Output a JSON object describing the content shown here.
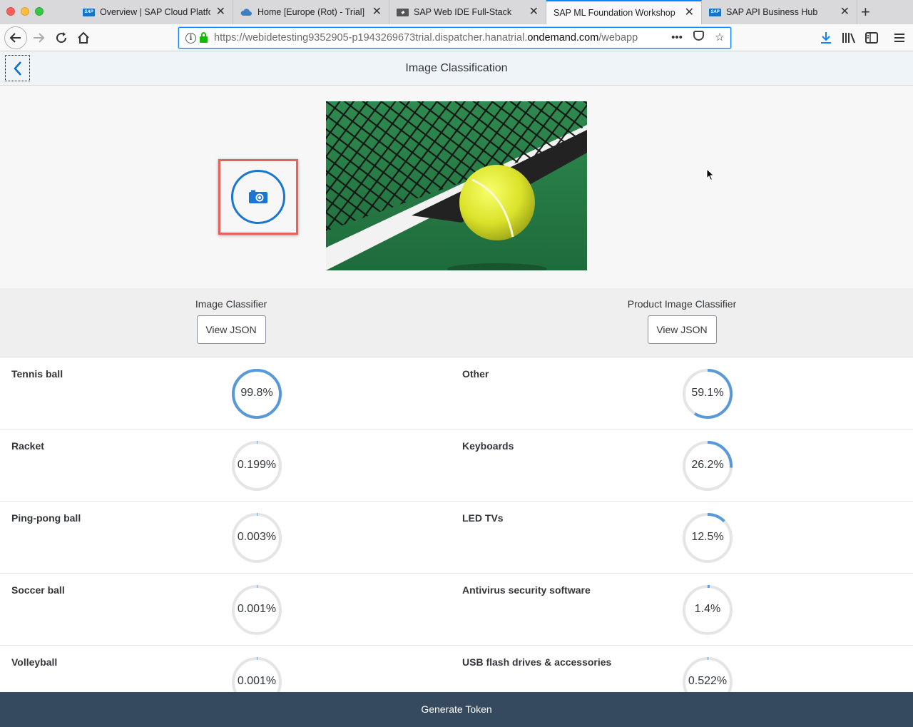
{
  "browser": {
    "tabs": [
      {
        "title": "Overview | SAP Cloud Platform",
        "favicon": "sap-logo-icon",
        "active": false
      },
      {
        "title": "Home [Europe (Rot) - Trial] > ",
        "favicon": "cloud-icon",
        "active": false
      },
      {
        "title": "SAP Web IDE Full-Stack",
        "favicon": "web-ide-icon",
        "active": false
      },
      {
        "title": "SAP ML Foundation Workshop",
        "favicon": "none",
        "active": true
      },
      {
        "title": "SAP API Business Hub",
        "favicon": "sap-logo-icon",
        "active": false
      }
    ],
    "url_prefix": "https://webidetesting9352905-p1943269673trial.dispatcher.hanatrial.",
    "url_domain": "ondemand.com",
    "url_suffix": "/webapp",
    "accent": "#0a84ff"
  },
  "app": {
    "title": "Image Classification",
    "accent": "#1a76d2",
    "image_description_icon": "camera-icon"
  },
  "classifiers": [
    {
      "title": "Image Classifier",
      "button": "View JSON"
    },
    {
      "title": "Product Image Classifier",
      "button": "View JSON"
    }
  ],
  "results": {
    "left": [
      {
        "label": "Tennis ball",
        "value": "99.8%",
        "fraction": 0.998
      },
      {
        "label": "Racket",
        "value": "0.199%",
        "fraction": 0.00199
      },
      {
        "label": "Ping-pong ball",
        "value": "0.003%",
        "fraction": 3e-05
      },
      {
        "label": "Soccer ball",
        "value": "0.001%",
        "fraction": 1e-05
      },
      {
        "label": "Volleyball",
        "value": "0.001%",
        "fraction": 1e-05
      }
    ],
    "right": [
      {
        "label": "Other",
        "value": "59.1%",
        "fraction": 0.591
      },
      {
        "label": "Keyboards",
        "value": "26.2%",
        "fraction": 0.262
      },
      {
        "label": "LED TVs",
        "value": "12.5%",
        "fraction": 0.125
      },
      {
        "label": "Antivirus security software",
        "value": "1.4%",
        "fraction": 0.014
      },
      {
        "label": "USB flash drives & accessories",
        "value": "0.522%",
        "fraction": 0.00522
      }
    ]
  },
  "footer": {
    "button": "Generate Token"
  }
}
